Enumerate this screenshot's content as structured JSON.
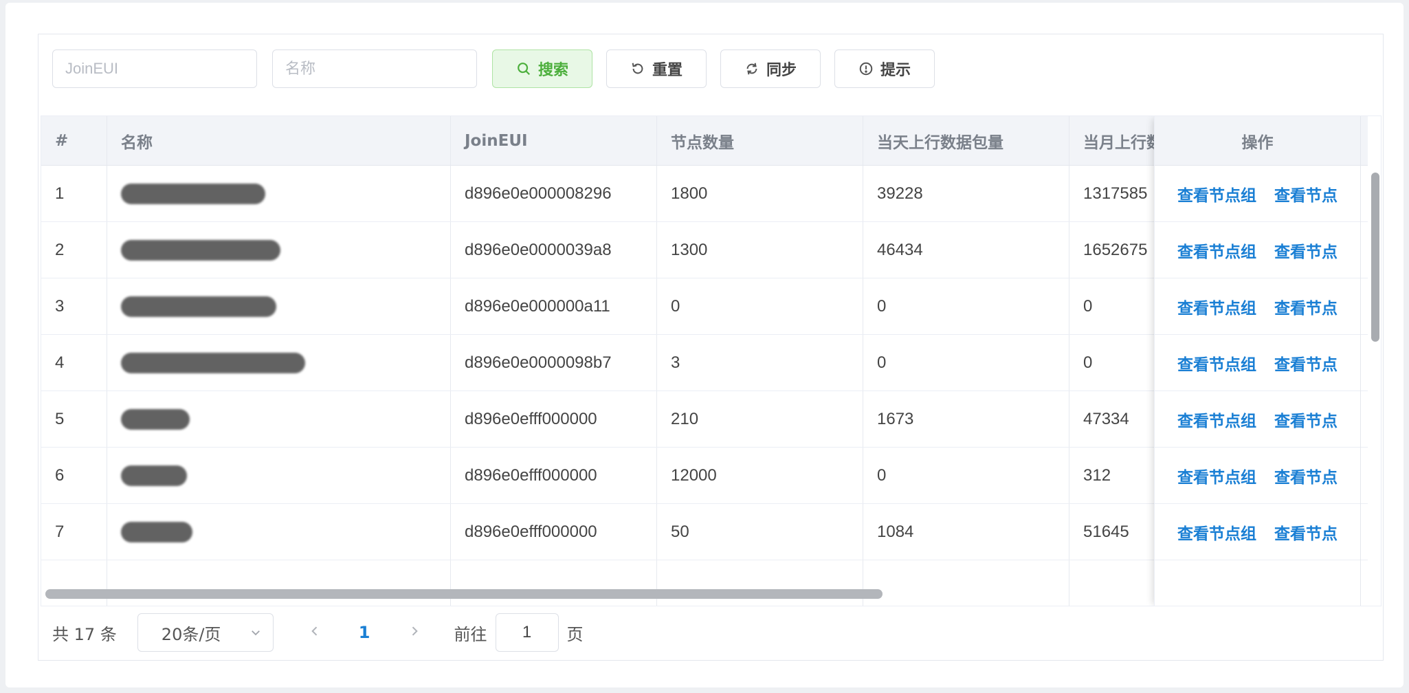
{
  "search": {
    "joineui_placeholder": "JoinEUI",
    "name_placeholder": "名称",
    "search_label": "搜索",
    "reset_label": "重置",
    "sync_label": "同步",
    "hint_label": "提示"
  },
  "table": {
    "headers": {
      "index": "#",
      "name": "名称",
      "joineui": "JoinEUI",
      "node_count": "节点数量",
      "daily_uplink": "当天上行数据包量",
      "monthly_uplink": "当月上行数",
      "actions": "操作"
    },
    "action_labels": {
      "view_groups": "查看节点组",
      "view_nodes": "查看节点"
    },
    "rows": [
      {
        "index": "1",
        "joineui": "d896e0e000008296",
        "node_count": "1800",
        "daily_uplink": "39228",
        "monthly_uplink": "1317585"
      },
      {
        "index": "2",
        "joineui": "d896e0e0000039a8",
        "node_count": "1300",
        "daily_uplink": "46434",
        "monthly_uplink": "1652675"
      },
      {
        "index": "3",
        "joineui": "d896e0e000000a11",
        "node_count": "0",
        "daily_uplink": "0",
        "monthly_uplink": "0"
      },
      {
        "index": "4",
        "joineui": "d896e0e0000098b7",
        "node_count": "3",
        "daily_uplink": "0",
        "monthly_uplink": "0"
      },
      {
        "index": "5",
        "joineui": "d896e0efff000000",
        "node_count": "210",
        "daily_uplink": "1673",
        "monthly_uplink": "47334"
      },
      {
        "index": "6",
        "joineui": "d896e0efff000000",
        "node_count": "12000",
        "daily_uplink": "0",
        "monthly_uplink": "312"
      },
      {
        "index": "7",
        "joineui": "d896e0efff000000",
        "node_count": "50",
        "daily_uplink": "1084",
        "monthly_uplink": "51645"
      }
    ]
  },
  "pagination": {
    "total": "共 17 条",
    "page_size": "20条/页",
    "current_page": "1",
    "goto_prefix": "前往",
    "goto_value": "1",
    "goto_suffix": "页"
  },
  "colors": {
    "link": "#1a7fd4",
    "primary_button_bg": "#e8f8e6",
    "primary_button_text": "#4caf3c",
    "header_bg": "#f2f4f8"
  }
}
